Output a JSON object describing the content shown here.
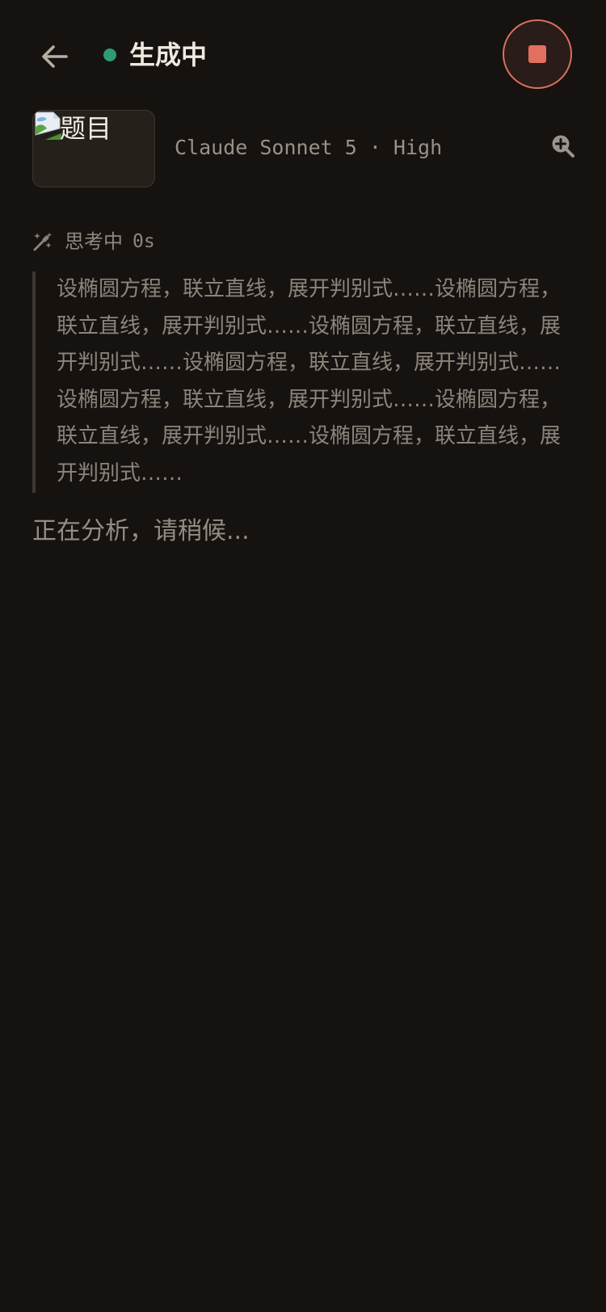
{
  "header": {
    "status_title": "生成中",
    "status_color": "#2e9b72",
    "back_icon": "arrow-left-icon",
    "stop_icon": "stop-icon",
    "stop_color": "#e36f5e"
  },
  "attachment": {
    "alt_text": "题目",
    "icon": "broken-image-icon"
  },
  "model": {
    "label": "Claude Sonnet 5 · High",
    "zoom_icon": "zoom-in-icon"
  },
  "thinking": {
    "label": "思考中",
    "elapsed": "0s",
    "icon": "magic-wand-icon",
    "content": "设椭圆方程，联立直线，展开判别式……设椭圆方程，联立直线，展开判别式……设椭圆方程，联立直线，展开判别式……设椭圆方程，联立直线，展开判别式……设椭圆方程，联立直线，展开判别式……设椭圆方程，联立直线，展开判别式……设椭圆方程，联立直线，展开判别式……"
  },
  "status_message": "正在分析，请稍候..."
}
